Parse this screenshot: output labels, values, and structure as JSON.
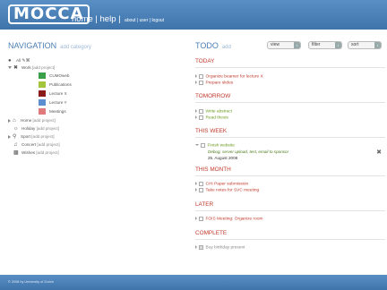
{
  "header": {
    "logo": "MOCCA",
    "nav_main": "home | help |",
    "nav_small": "about | user | logout"
  },
  "navigation": {
    "title": "NAVIGATION",
    "add": "add category",
    "all": "All",
    "tree": [
      {
        "label": "Work",
        "add": "[add project]"
      },
      {
        "label": "CUMOweb",
        "color": "#3aa14a"
      },
      {
        "label": "Publications",
        "color": "#a4c43a"
      },
      {
        "label": "Lecture X",
        "color": "#8b1a1a"
      },
      {
        "label": "Lecture Y",
        "color": "#5b8fd0"
      },
      {
        "label": "Meetings",
        "color": "#e07a7a"
      },
      {
        "label": "Home",
        "add": "[add project]"
      },
      {
        "label": "Holiday",
        "add": "[add project]"
      },
      {
        "label": "Sport",
        "add": "[add project]"
      },
      {
        "label": "Concert",
        "add": "[add project]"
      },
      {
        "label": "Wishes",
        "add": "[add project]"
      }
    ]
  },
  "todo": {
    "title": "TODO",
    "add": "add",
    "view": "view",
    "filter": "filter",
    "sort": "sort",
    "sections": {
      "today": "TODAY",
      "tomorrow": "TOMORROW",
      "this_week": "THIS WEEK",
      "this_month": "THIS MONTH",
      "later": "LATER",
      "complete": "COMPLETE"
    },
    "tasks": {
      "t1": "Organize beamer for lecture X",
      "t2": "Prepare slides",
      "t3": "Write abstract",
      "t4": "Read thesis",
      "t5": "Finish website",
      "t5_detail": "Debug, server upload, test, email to sponsor",
      "t5_date": "25. August 2008",
      "t6": "CHI Paper submission",
      "t7": "Take notes for SVC meeting",
      "t8": "FOIS Meeting: Organize room",
      "t9": "Buy birthday present"
    }
  },
  "footer": {
    "text": "© 2008 by University of Zurich"
  }
}
